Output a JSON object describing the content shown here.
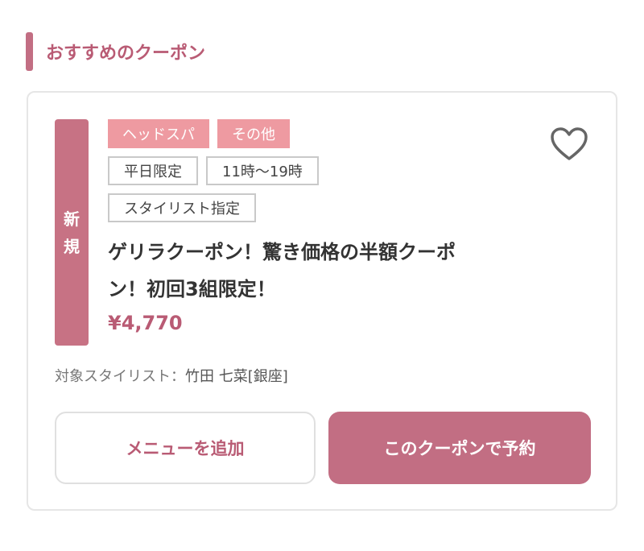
{
  "section": {
    "title": "おすすめのクーポン"
  },
  "coupon": {
    "new_badge": [
      "新",
      "規"
    ],
    "category_tags": [
      "ヘッドスパ",
      "その他"
    ],
    "condition_tags": [
      "平日限定",
      "11時〜19時"
    ],
    "stylist_tag": "スタイリスト指定",
    "title_line1": "ゲリラクーポン！驚き価格の半額クーポ",
    "title_line2": "ン！初回3組限定！",
    "price": "¥4,770",
    "stylist_label": "対象スタイリスト：",
    "stylist_name": "竹田 七菜[銀座]",
    "favorite_icon": "heart-outline-icon"
  },
  "buttons": {
    "add_menu": "メニューを追加",
    "reserve": "このクーポンで予約"
  },
  "colors": {
    "accent": "#c26e83",
    "accent_text": "#b95b74",
    "tag_filled": "#ee9aa1",
    "border": "#e6e6e6"
  }
}
